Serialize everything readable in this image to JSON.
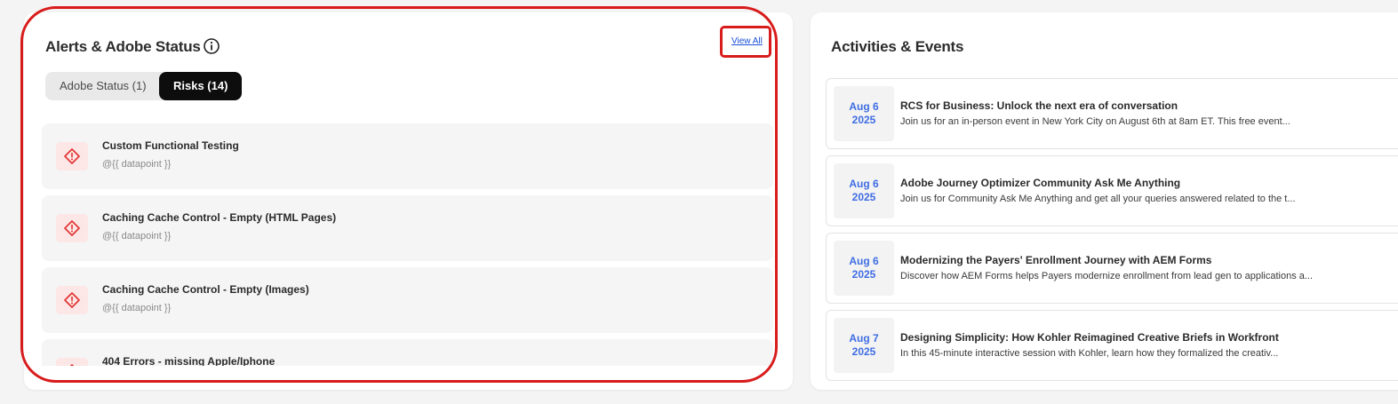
{
  "alerts_panel": {
    "title": "Alerts & Adobe Status",
    "view_all": "View All",
    "tabs": [
      {
        "label": "Adobe Status (1)",
        "active": false
      },
      {
        "label": "Risks (14)",
        "active": true
      }
    ],
    "items": [
      {
        "title": "Custom Functional Testing",
        "subtitle": "@{{ datapoint }}",
        "icon": "warning-diamond-icon"
      },
      {
        "title": "Caching Cache Control - Empty (HTML Pages)",
        "subtitle": "@{{ datapoint }}",
        "icon": "warning-diamond-icon"
      },
      {
        "title": "Caching Cache Control - Empty (Images)",
        "subtitle": "@{{ datapoint }}",
        "icon": "warning-diamond-icon"
      },
      {
        "title": "404 Errors - missing Apple/Iphone",
        "subtitle": "",
        "icon": "warning-diamond-icon"
      }
    ]
  },
  "events_panel": {
    "title": "Activities & Events",
    "items": [
      {
        "month_day": "Aug 6",
        "year": "2025",
        "title": "RCS for Business: Unlock the next era of conversation",
        "description": "Join us for an in-person event in New York City on August 6th at 8am ET. This free event..."
      },
      {
        "month_day": "Aug 6",
        "year": "2025",
        "title": "Adobe Journey Optimizer Community Ask Me Anything",
        "description": "Join us for Community Ask Me Anything and get all your queries answered related to the t..."
      },
      {
        "month_day": "Aug 6",
        "year": "2025",
        "title": "Modernizing the Payers' Enrollment Journey with AEM Forms",
        "description": "Discover how AEM Forms helps Payers modernize enrollment from lead gen to applications a..."
      },
      {
        "month_day": "Aug 7",
        "year": "2025",
        "title": "Designing Simplicity: How Kohler Reimagined Creative Briefs in Workfront",
        "description": "In this 45-minute interactive session with Kohler, learn how they formalized the creativ..."
      }
    ]
  },
  "colors": {
    "highlight": "#d81b1b",
    "date_accent": "#3f6de3",
    "alert_icon": "#e0312f",
    "active_tab": "#0d0d0d"
  }
}
